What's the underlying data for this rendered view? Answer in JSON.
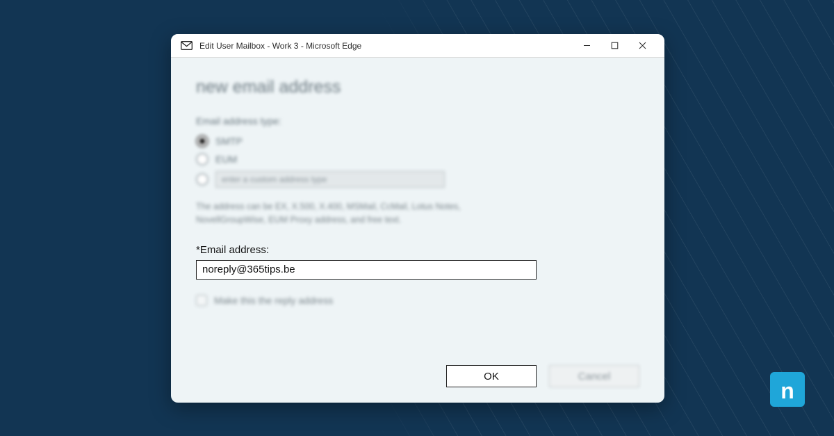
{
  "window": {
    "title": "Edit User Mailbox - Work 3 - Microsoft Edge"
  },
  "form": {
    "heading": "new email address",
    "type_label": "Email address type:",
    "options": {
      "smtp": "SMTP",
      "eum": "EUM",
      "custom_placeholder": "enter a custom address type"
    },
    "helper_text": "The address can be EX, X.500, X.400, MSMail, CcMail, Lotus Notes, NovellGroupWise, EUM Proxy address, and free text.",
    "email_label": "*Email address:",
    "email_value": "noreply@365tips.be",
    "reply_checkbox_label": "Make this the reply address"
  },
  "buttons": {
    "ok": "OK",
    "cancel": "Cancel"
  },
  "logo": {
    "letter": "n"
  }
}
